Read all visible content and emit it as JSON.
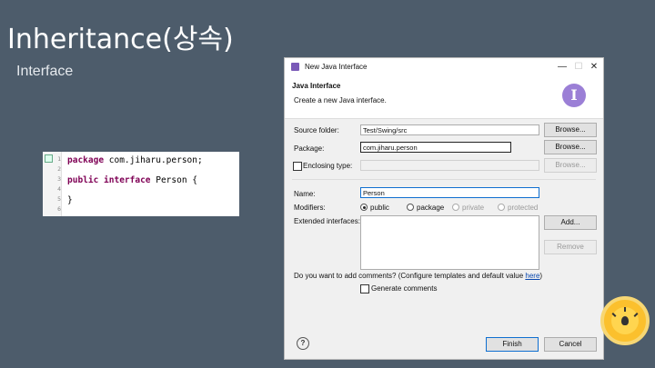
{
  "slide": {
    "title": "Inheritance(상속)",
    "subtitle": "Interface"
  },
  "code": {
    "line_numbers": [
      "1",
      "2",
      "3",
      "4",
      "5",
      "6"
    ],
    "lines": [
      {
        "kw": "package",
        "rest": " com.jiharu.person;"
      },
      {
        "kw": "",
        "rest": ""
      },
      {
        "kw": "public interface",
        "rest": " Person {"
      },
      {
        "kw": "",
        "rest": ""
      },
      {
        "kw": "",
        "rest": "}"
      },
      {
        "kw": "",
        "rest": ""
      }
    ]
  },
  "dialog": {
    "window_title": "New Java Interface",
    "minimize": "—",
    "maximize": "☐",
    "close": "✕",
    "header_title": "Java Interface",
    "header_desc": "Create a new Java interface.",
    "logo_letter": "I",
    "source_folder_label": "Source folder:",
    "source_folder_value": "Test/Swing/src",
    "package_label": "Package:",
    "package_value": "com.jiharu.person",
    "enclosing_label": "Enclosing type:",
    "enclosing_value": "",
    "browse_label": "Browse...",
    "name_label": "Name:",
    "name_value": "Person",
    "modifiers_label": "Modifiers:",
    "modifiers": [
      {
        "label": "public",
        "selected": true,
        "enabled": true
      },
      {
        "label": "package",
        "selected": false,
        "enabled": true
      },
      {
        "label": "private",
        "selected": false,
        "enabled": false
      },
      {
        "label": "protected",
        "selected": false,
        "enabled": false
      }
    ],
    "extended_label": "Extended interfaces:",
    "add_label": "Add...",
    "remove_label": "Remove",
    "comments_question": "Do you want to add comments? (Configure templates and default value ",
    "comments_link": "here",
    "comments_tail": ")",
    "generate_comments": "Generate comments",
    "help_icon": "?",
    "finish_label": "Finish",
    "cancel_label": "Cancel"
  },
  "colors": {
    "background": "#4d5c6b",
    "accent": "#0f6fd0",
    "clock": "#fbc02d"
  }
}
